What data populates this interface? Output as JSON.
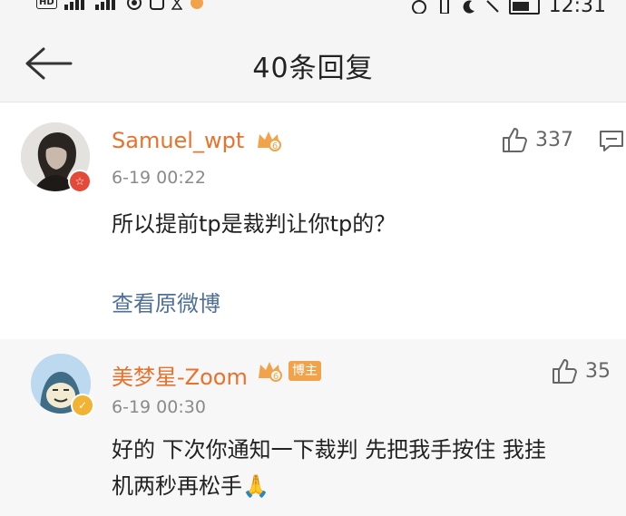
{
  "status_bar": {
    "hd_label": "HD",
    "time": "12:31"
  },
  "nav": {
    "title": "40条回复"
  },
  "comments": [
    {
      "username": "Samuel_wpt",
      "timestamp": "6-19 00:22",
      "content": "所以提前tp是裁判让你tp的？",
      "view_original": "查看原微博",
      "likes": "337",
      "crown_level": "6",
      "avatar_badge": "☆"
    },
    {
      "username": "美梦星-Zoom",
      "timestamp": "6-19 00:30",
      "content_line1": "好的 下次你通知一下裁判 先把我手按住 我挂",
      "content_line2": "机两秒再松手🙏",
      "likes": "35",
      "crown_level": "6",
      "tag": "博主",
      "avatar_badge": "✓"
    }
  ],
  "colors": {
    "username": "#e8722c",
    "link": "#4f6f99",
    "crown": "#f1a34c"
  }
}
